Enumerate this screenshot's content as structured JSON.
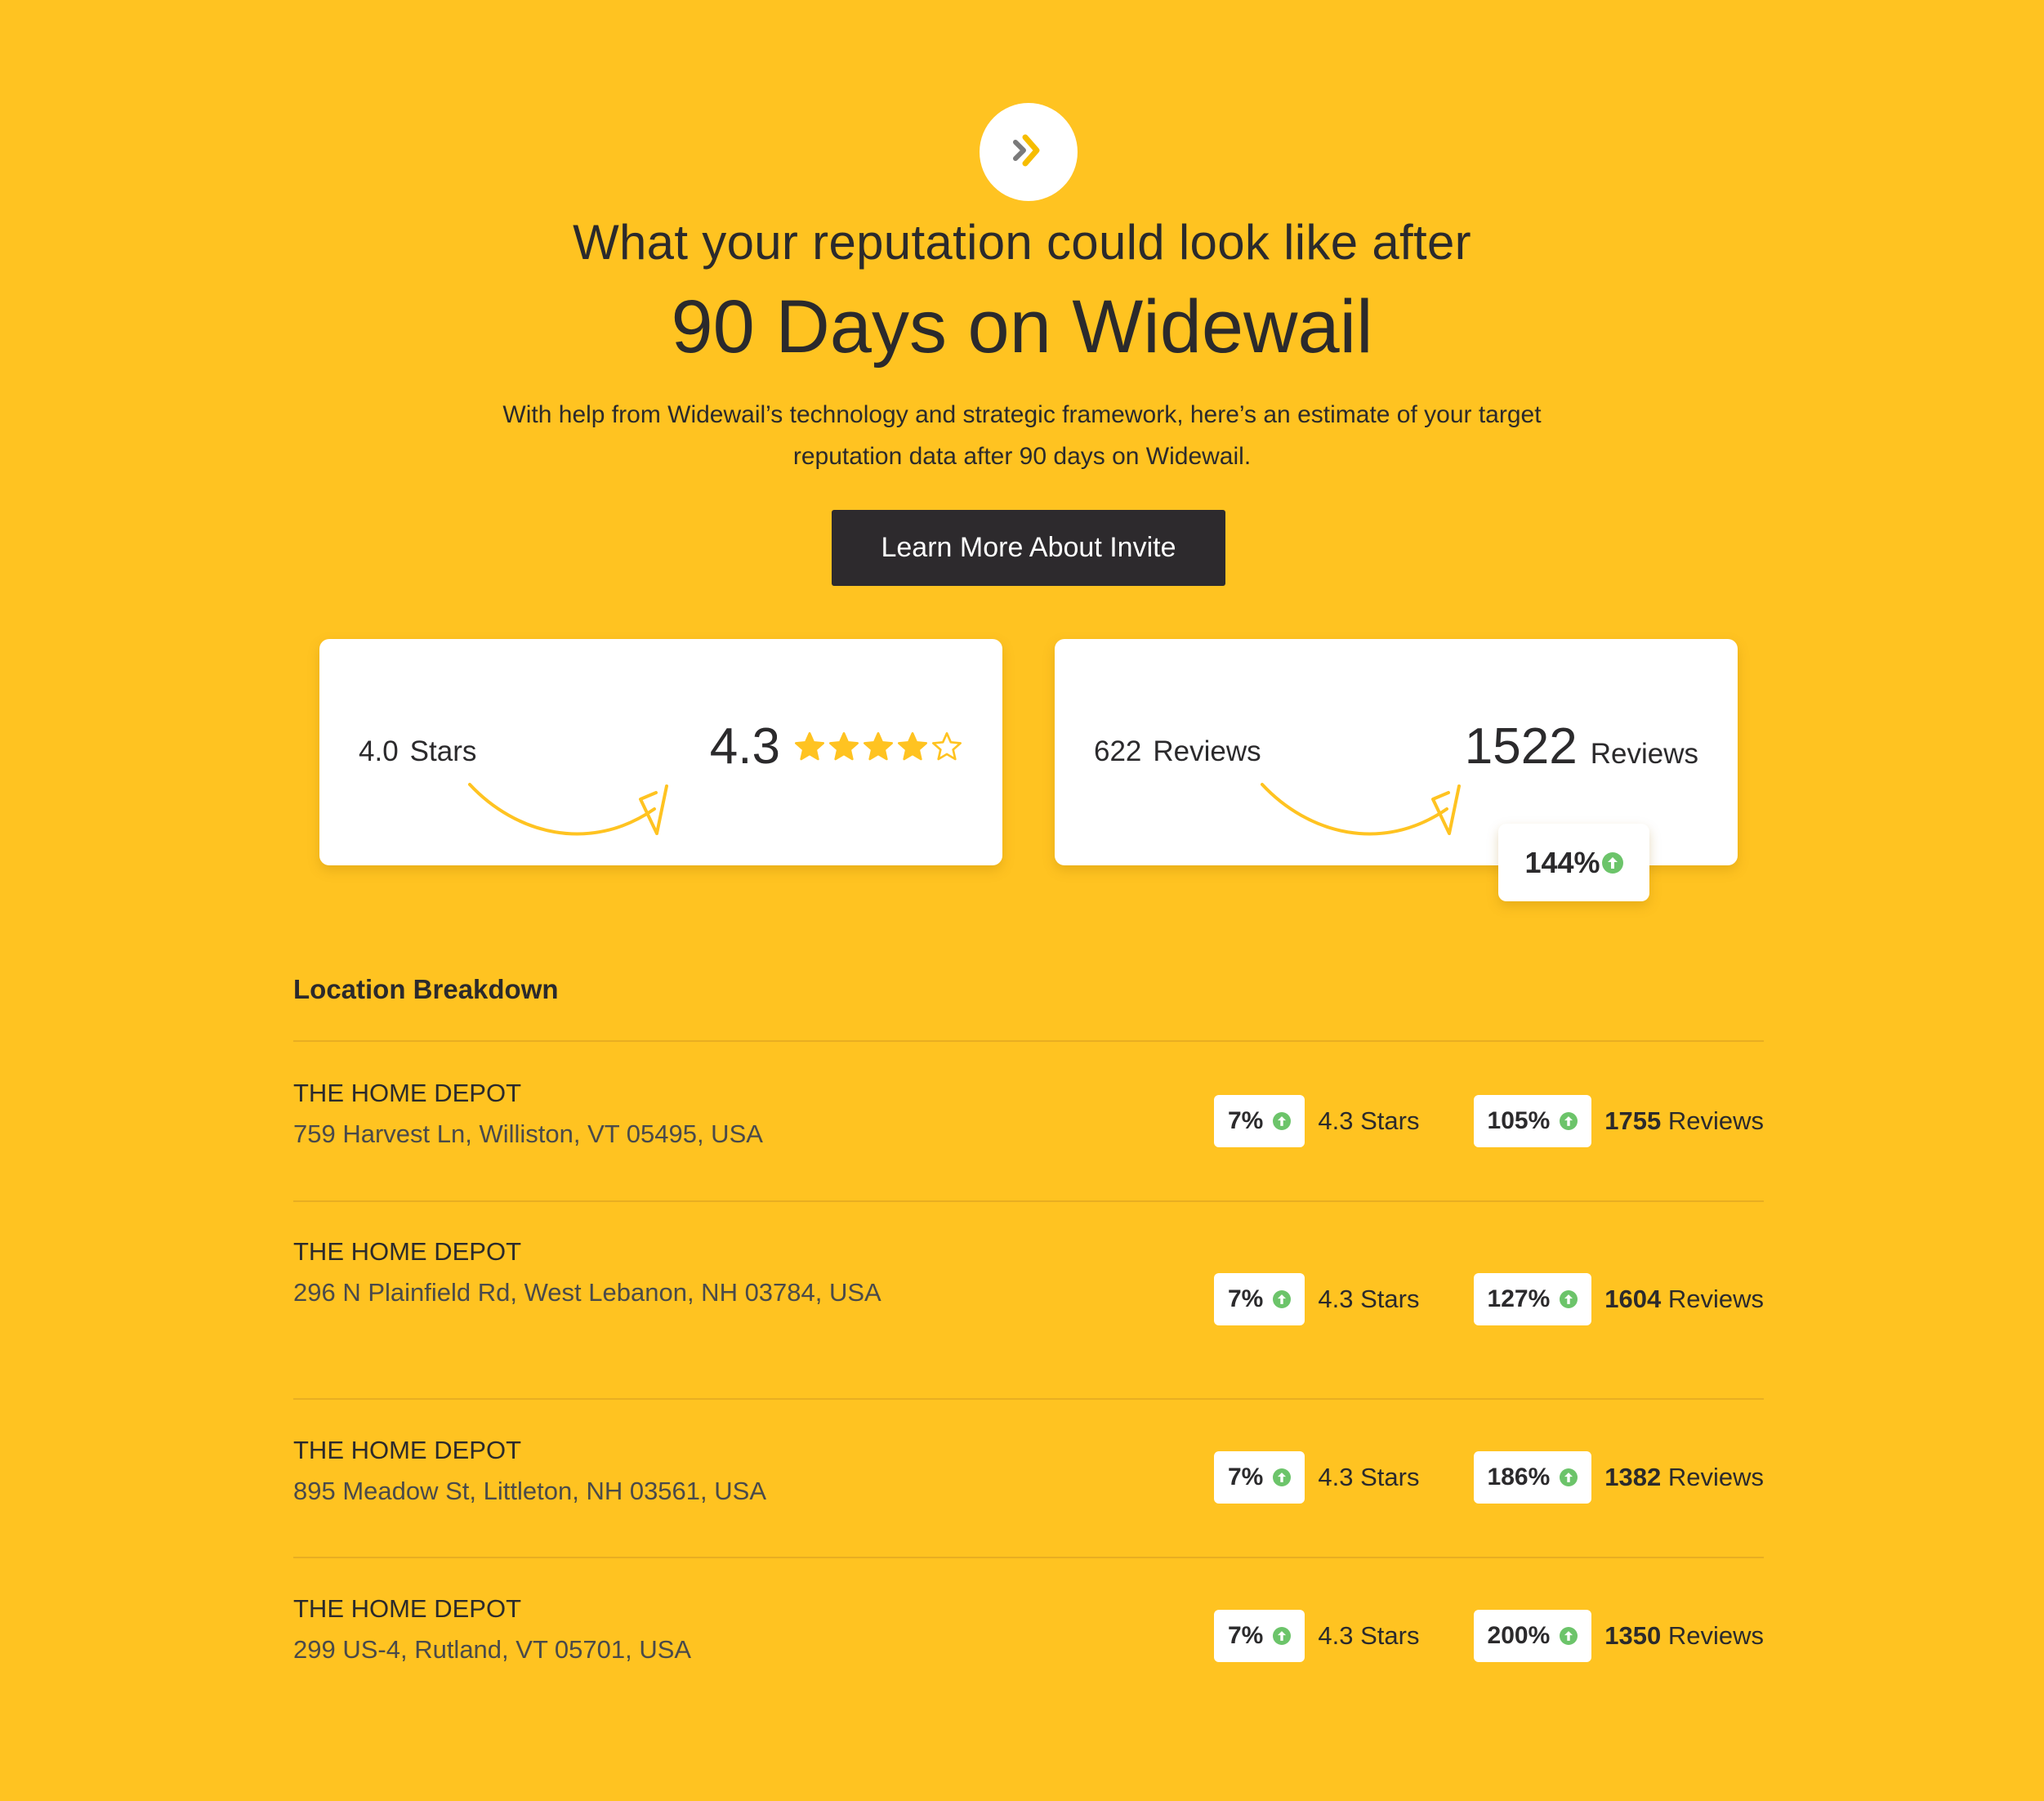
{
  "brand": {
    "logo_icon": "double-chevron-right-icon",
    "accent": "#FFC321",
    "dark": "#2D2A2D",
    "green": "#6CC46A"
  },
  "hero": {
    "title_line1": "What your reputation could look like after",
    "title_line2": "90 Days on Widewail",
    "subtitle_line1": "With help from Widewail’s technology and strategic framework, here’s an estimate of your target",
    "subtitle_line2": "reputation data after 90 days on Widewail.",
    "cta_label": "Learn More About Invite"
  },
  "summary": {
    "rating": {
      "from_value": "4.0",
      "from_unit": "Stars",
      "to_value": "4.3",
      "stars_filled": 4,
      "stars_total": 5
    },
    "reviews": {
      "from_value": "622",
      "from_unit": "Reviews",
      "to_value": "1522",
      "to_unit": "Reviews",
      "change": "144%"
    }
  },
  "breakdown": {
    "title": "Location Breakdown",
    "locations": [
      {
        "name": "THE HOME DEPOT",
        "address": "759 Harvest Ln, Williston, VT 05495, USA",
        "rating_change": "7%",
        "rating": "4.3",
        "rating_unit": "Stars",
        "reviews_change": "105%",
        "reviews": "1755",
        "reviews_unit": "Reviews"
      },
      {
        "name": "THE HOME DEPOT",
        "address": "296 N Plainfield Rd, West Lebanon, NH 03784, USA",
        "rating_change": "7%",
        "rating": "4.3",
        "rating_unit": "Stars",
        "reviews_change": "127%",
        "reviews": "1604",
        "reviews_unit": "Reviews"
      },
      {
        "name": "THE HOME DEPOT",
        "address": "895 Meadow St, Littleton, NH 03561, USA",
        "rating_change": "7%",
        "rating": "4.3",
        "rating_unit": "Stars",
        "reviews_change": "186%",
        "reviews": "1382",
        "reviews_unit": "Reviews"
      },
      {
        "name": "THE HOME DEPOT",
        "address": "299 US-4, Rutland, VT 05701, USA",
        "rating_change": "7%",
        "rating": "4.3",
        "rating_unit": "Stars",
        "reviews_change": "200%",
        "reviews": "1350",
        "reviews_unit": "Reviews"
      }
    ]
  }
}
